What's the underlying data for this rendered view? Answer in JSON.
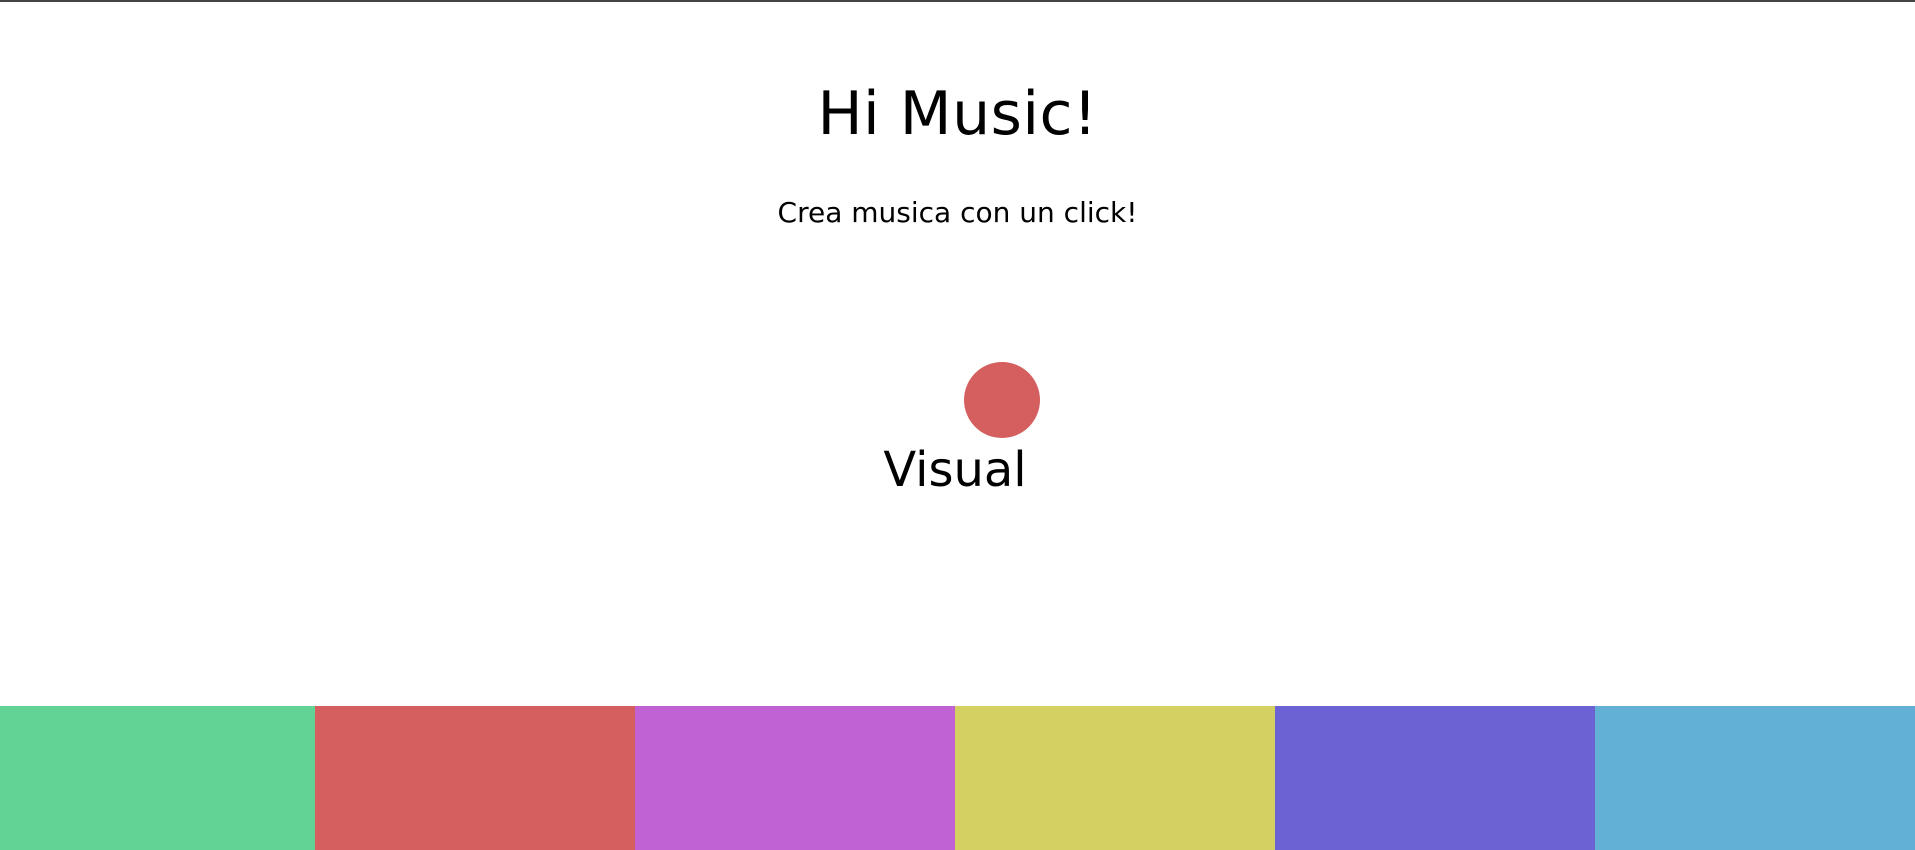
{
  "header": {
    "title": "Hi Music!",
    "subtitle": "Crea musica con un click!"
  },
  "visual": {
    "label": "Visual",
    "circle_color": "#d55f5f"
  },
  "pads": [
    {
      "color": "#62d394"
    },
    {
      "color": "#d55f5f"
    },
    {
      "color": "#c062d4"
    },
    {
      "color": "#d4d162"
    },
    {
      "color": "#6c62d4"
    },
    {
      "color": "#62b0d4"
    }
  ]
}
